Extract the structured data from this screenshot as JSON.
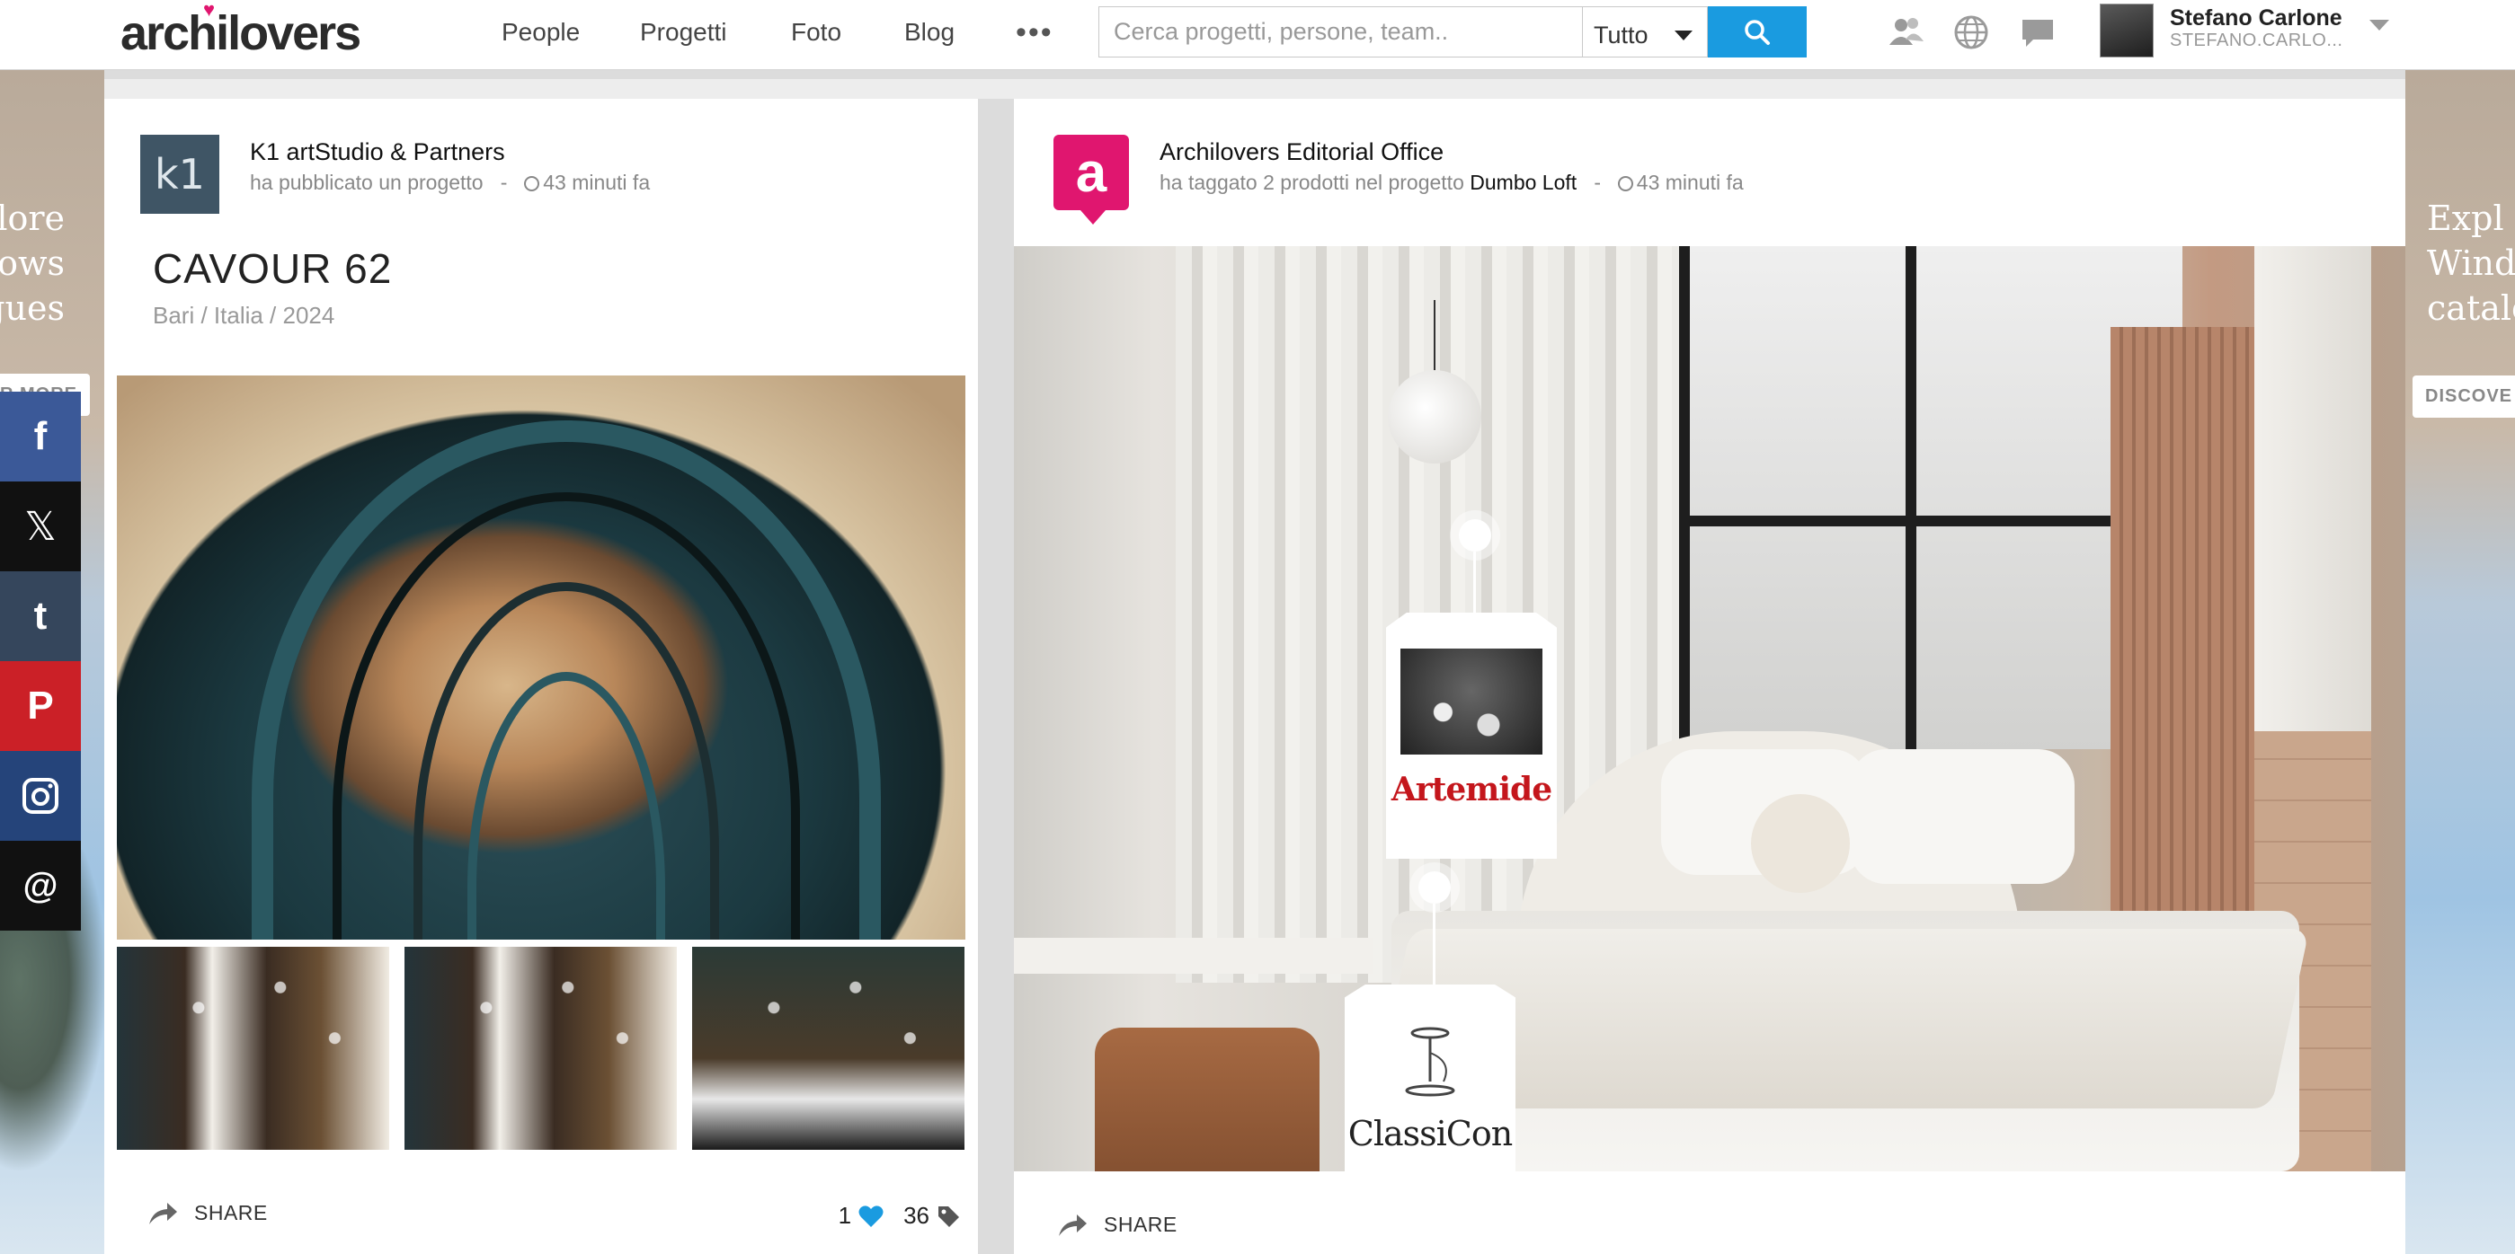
{
  "brand": {
    "logo": "archilovers",
    "accent": "#e0166f",
    "search_accent": "#1a9be0"
  },
  "nav": {
    "people": "People",
    "progetti": "Progetti",
    "foto": "Foto",
    "blog": "Blog",
    "more": "•••"
  },
  "search": {
    "placeholder": "Cerca progetti, persone, team..",
    "value": "",
    "filter": "Tutto"
  },
  "header_icons": [
    "people-icon",
    "globe-icon",
    "chat-icon"
  ],
  "user": {
    "name": "Stefano Carlone",
    "handle": "STEFANO.CARLO..."
  },
  "social": [
    "facebook",
    "x",
    "tumblr",
    "pinterest",
    "instagram",
    "threads"
  ],
  "ads": {
    "left_text": [
      "lore",
      "lows",
      "ogues"
    ],
    "left_button": "R MORE",
    "right_text": [
      "Expl",
      "Wind",
      "catalo"
    ],
    "right_button": "DISCOVE"
  },
  "post_left": {
    "avatar_text": "k1",
    "author": "K1 artStudio & Partners",
    "action": "ha pubblicato un progetto",
    "separator": "-",
    "time": "43 minuti fa",
    "title": "CAVOUR 62",
    "subtitle": "Bari / Italia / 2024",
    "share": "SHARE",
    "likes": "1",
    "tags": "36"
  },
  "post_right": {
    "avatar_text": "a",
    "author": "Archilovers Editorial Office",
    "action": "ha taggato 2 prodotti nel progetto",
    "project": "Dumbo Loft",
    "separator": "-",
    "time": "43 minuti fa",
    "share": "SHARE",
    "product_tags": [
      {
        "brand": "Artemide"
      },
      {
        "brand": "ClassiCon"
      }
    ]
  }
}
